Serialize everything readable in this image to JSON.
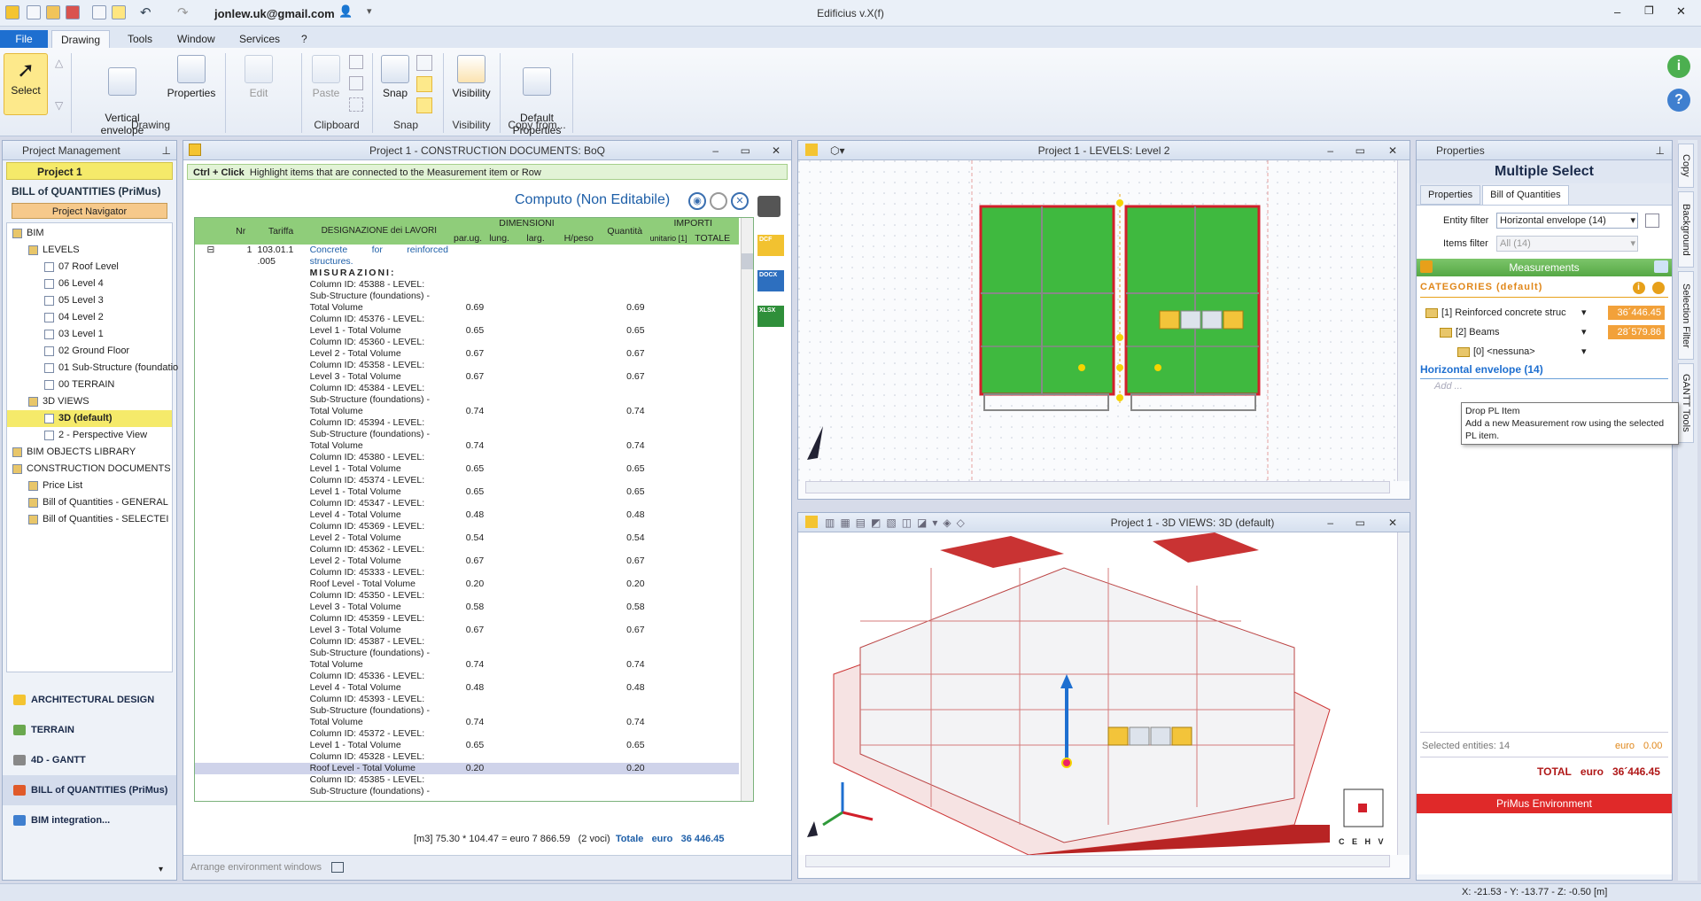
{
  "app": {
    "title": "Edificius v.X(f)",
    "user": "jonlew.uk@gmail.com"
  },
  "ribbon_tabs": [
    "File",
    "Drawing",
    "Tools",
    "Window",
    "Services",
    "?"
  ],
  "ribbon": {
    "select": "Select",
    "vertical_envelope": "Vertical\nenvelope",
    "properties": "Properties",
    "edit": "Edit",
    "paste": "Paste",
    "snap": "Snap",
    "visibility": "Visibility",
    "default_properties": "Default\nProperties",
    "groups": {
      "drawing": "Drawing",
      "clipboard": "Clipboard",
      "snap": "Snap",
      "visibility": "Visibility",
      "copy_from": "Copy from..."
    }
  },
  "left": {
    "header": "Project Management",
    "project": "Project 1",
    "section": "BILL of QUANTITIES (PriMus)",
    "navigator": "Project Navigator",
    "tree": [
      {
        "t": "BIM",
        "lvl": 0
      },
      {
        "t": "LEVELS",
        "lvl": 1
      },
      {
        "t": "07 Roof Level",
        "lvl": 2
      },
      {
        "t": "06 Level 4",
        "lvl": 2
      },
      {
        "t": "05 Level 3",
        "lvl": 2
      },
      {
        "t": "04 Level 2",
        "lvl": 2
      },
      {
        "t": "03 Level 1",
        "lvl": 2
      },
      {
        "t": "02 Ground Floor",
        "lvl": 2
      },
      {
        "t": "01 Sub-Structure (foundatio",
        "lvl": 2
      },
      {
        "t": "00 TERRAIN",
        "lvl": 2
      },
      {
        "t": "3D VIEWS",
        "lvl": 1
      },
      {
        "t": "3D (default)",
        "lvl": 2,
        "sel": true
      },
      {
        "t": "2 - Perspective View",
        "lvl": 2
      },
      {
        "t": "BIM OBJECTS LIBRARY",
        "lvl": 0
      },
      {
        "t": "CONSTRUCTION DOCUMENTS",
        "lvl": 0
      },
      {
        "t": "Price List",
        "lvl": 1
      },
      {
        "t": "Bill of Quantities - GENERAL",
        "lvl": 1
      },
      {
        "t": "Bill of Quantities - SELECTEI",
        "lvl": 1
      }
    ],
    "nav": [
      "ARCHITECTURAL DESIGN",
      "TERRAIN",
      "4D - GANTT",
      "BILL of QUANTITIES (PriMus)",
      "BIM integration..."
    ]
  },
  "boq": {
    "title": "Project 1 -  CONSTRUCTION DOCUMENTS: BoQ",
    "hint_key": "Ctrl + Click",
    "hint": "Highlight items that are connected to the Measurement item or Row",
    "computo": "Computo (Non Editabile)",
    "headers": {
      "nr": "Nr",
      "tariffa": "Tariffa",
      "designazione": "DESIGNAZIONE dei LAVORI",
      "dimensioni": "DIMENSIONI",
      "parug": "par.ug.",
      "lung": "lung.",
      "larg": "larg.",
      "hpeso": "H/peso",
      "quantita": "Quantità",
      "importi": "IMPORTI",
      "unitario": "unitario [1]",
      "totale": "TOTALE"
    },
    "item_nr": "1",
    "item_code": "103.01.1\n.005",
    "item_desc": "Concrete for reinforced structures.",
    "misurazioni": "MISURAZIONI:",
    "rows": [
      {
        "d": "Column ID: 45388 - LEVEL:"
      },
      {
        "d": "Sub-Structure (foundations) -"
      },
      {
        "d": "Total Volume",
        "p": "0.69",
        "q": "0.69"
      },
      {
        "d": "Column ID: 45376 - LEVEL:"
      },
      {
        "d": "Level 1 - Total Volume",
        "p": "0.65",
        "q": "0.65"
      },
      {
        "d": "Column ID: 45360 - LEVEL:"
      },
      {
        "d": "Level 2 - Total Volume",
        "p": "0.67",
        "q": "0.67"
      },
      {
        "d": "Column ID: 45358 - LEVEL:"
      },
      {
        "d": "Level 3 - Total Volume",
        "p": "0.67",
        "q": "0.67"
      },
      {
        "d": "Column ID: 45384 - LEVEL:"
      },
      {
        "d": "Sub-Structure (foundations) -"
      },
      {
        "d": "Total Volume",
        "p": "0.74",
        "q": "0.74"
      },
      {
        "d": "Column ID: 45394 - LEVEL:"
      },
      {
        "d": "Sub-Structure (foundations) -"
      },
      {
        "d": "Total Volume",
        "p": "0.74",
        "q": "0.74"
      },
      {
        "d": "Column ID: 45380 - LEVEL:"
      },
      {
        "d": "Level 1 - Total Volume",
        "p": "0.65",
        "q": "0.65"
      },
      {
        "d": "Column ID: 45374 - LEVEL:"
      },
      {
        "d": "Level 1 - Total Volume",
        "p": "0.65",
        "q": "0.65"
      },
      {
        "d": "Column ID: 45347 - LEVEL:"
      },
      {
        "d": "Level 4 - Total Volume",
        "p": "0.48",
        "q": "0.48"
      },
      {
        "d": "Column ID: 45369 - LEVEL:"
      },
      {
        "d": "Level 2 - Total Volume",
        "p": "0.54",
        "q": "0.54"
      },
      {
        "d": "Column ID: 45362 - LEVEL:"
      },
      {
        "d": "Level 2 - Total Volume",
        "p": "0.67",
        "q": "0.67"
      },
      {
        "d": "Column ID: 45333 - LEVEL:"
      },
      {
        "d": "Roof Level - Total Volume",
        "p": "0.20",
        "q": "0.20"
      },
      {
        "d": "Column ID: 45350 - LEVEL:"
      },
      {
        "d": "Level 3 - Total Volume",
        "p": "0.58",
        "q": "0.58"
      },
      {
        "d": "Column ID: 45359 - LEVEL:"
      },
      {
        "d": "Level 3 - Total Volume",
        "p": "0.67",
        "q": "0.67"
      },
      {
        "d": "Column ID: 45387 - LEVEL:"
      },
      {
        "d": "Sub-Structure (foundations) -"
      },
      {
        "d": "Total Volume",
        "p": "0.74",
        "q": "0.74"
      },
      {
        "d": "Column ID: 45336 - LEVEL:"
      },
      {
        "d": "Level 4 - Total Volume",
        "p": "0.48",
        "q": "0.48"
      },
      {
        "d": "Column ID: 45393 - LEVEL:"
      },
      {
        "d": "Sub-Structure (foundations) -"
      },
      {
        "d": "Total Volume",
        "p": "0.74",
        "q": "0.74"
      },
      {
        "d": "Column ID: 45372 - LEVEL:"
      },
      {
        "d": "Level 1 - Total Volume",
        "p": "0.65",
        "q": "0.65"
      },
      {
        "d": "Column ID: 45328 - LEVEL:"
      },
      {
        "d": "Roof Level - Total Volume",
        "p": "0.20",
        "q": "0.20",
        "hl": true
      },
      {
        "d": "Column ID: 45385 - LEVEL:"
      },
      {
        "d": "Sub-Structure (foundations) -"
      }
    ],
    "footer_calc": "[m3] 75.30 * 104.47 = euro 7 866.59",
    "footer_voci": "(2 voci)",
    "footer_totale": "Totale",
    "footer_euro": "euro",
    "footer_amount": "36 446.45",
    "arrange": "Arrange environment windows",
    "export": [
      "DCF",
      "DOCX",
      "XLSX"
    ]
  },
  "level_view": {
    "title": "Project 1 -  LEVELS: Level 2"
  },
  "view3d": {
    "title": "Project 1 -  3D VIEWS: 3D (default)",
    "cube": "C E H V"
  },
  "props": {
    "header": "Properties",
    "title": "Multiple Select",
    "tabs": [
      "Properties",
      "Bill of Quantities"
    ],
    "entity_filter_label": "Entity filter",
    "entity_filter_value": "Horizontal envelope (14)",
    "items_filter_label": "Items filter",
    "items_filter_value": "All (14)",
    "measurements": "Measurements",
    "categories": "CATEGORIES (default)",
    "cat_rows": [
      {
        "label": "[1] Reinforced concrete struc",
        "amount": "36´446.45"
      },
      {
        "label": "[2] Beams",
        "amount": "28´579.86"
      },
      {
        "label": "[0] <nessuna>",
        "amount": ""
      }
    ],
    "he_link": "Horizontal envelope (14)",
    "add": "Add ...",
    "tooltip_title": "Drop PL Item",
    "tooltip_body": "Add a new Measurement row using the selected PL item.",
    "selected": "Selected entities: 14",
    "sel_euro": "euro",
    "sel_amount": "0.00",
    "total_label": "TOTAL",
    "total_euro": "euro",
    "total_amount": "36´446.45",
    "primus": "PriMus Environment"
  },
  "side_tabs": [
    "Copy",
    "Background",
    "Selection Filter",
    "GANTT Tools"
  ],
  "status": {
    "coords": "X: -21.53 - Y: -13.77 - Z: -0.50 [m]"
  },
  "colors": {
    "accent": "#1e6fd0",
    "red": "#e0242c",
    "green": "#3fb93f",
    "highlight": "#f5ea6a"
  }
}
